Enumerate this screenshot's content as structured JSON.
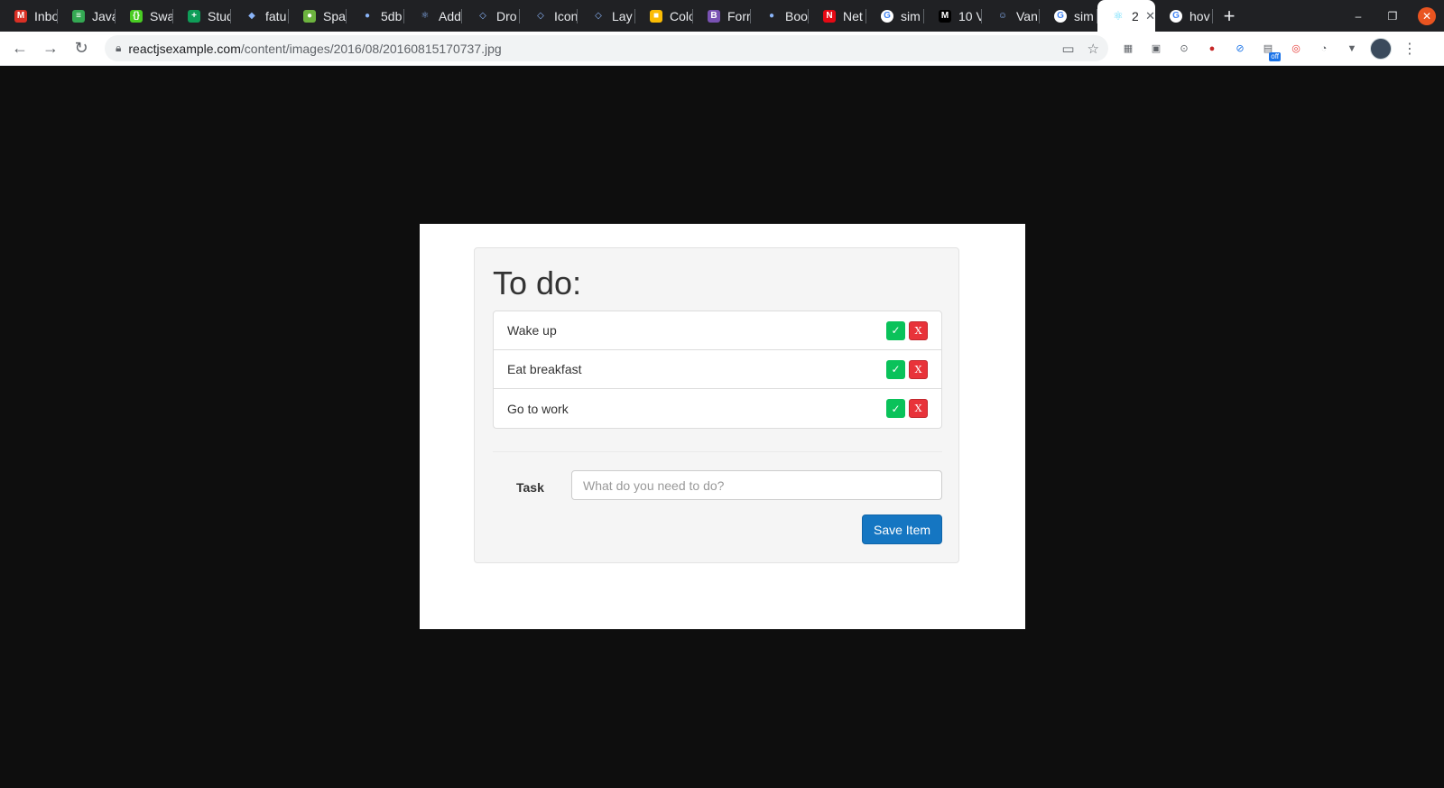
{
  "browser": {
    "tabs": [
      {
        "label": "Inbo",
        "icon": "gmail-icon",
        "color": "#d93025",
        "glyph": "M"
      },
      {
        "label": "Java",
        "icon": "code-icon",
        "color": "#34a853",
        "glyph": "≡"
      },
      {
        "label": "Swa",
        "icon": "swagger-icon",
        "color": "#49cc23",
        "glyph": "{}"
      },
      {
        "label": "Stud",
        "icon": "sheets-icon",
        "color": "#0f9d58",
        "glyph": "+"
      },
      {
        "label": "fatu",
        "icon": "shield-icon",
        "color": "#3c4043",
        "glyph": "◆"
      },
      {
        "label": "Spa",
        "icon": "spring-icon",
        "color": "#6db33f",
        "glyph": "●"
      },
      {
        "label": "5db",
        "icon": "globe-icon",
        "color": "#3c4043",
        "glyph": "●"
      },
      {
        "label": "Add",
        "icon": "react-icon",
        "color": "#202124",
        "glyph": "⚛"
      },
      {
        "label": "Dro",
        "icon": "diamond-icon",
        "color": "#202124",
        "glyph": "◇"
      },
      {
        "label": "Icon",
        "icon": "diamond-icon",
        "color": "#202124",
        "glyph": "◇"
      },
      {
        "label": "Lay",
        "icon": "diamond-icon",
        "color": "#202124",
        "glyph": "◇"
      },
      {
        "label": "Colo",
        "icon": "palette-icon",
        "color": "#fbbc04",
        "glyph": "■"
      },
      {
        "label": "Forr",
        "icon": "bootstrap-icon",
        "color": "#7952b3",
        "glyph": "B"
      },
      {
        "label": "Boo",
        "icon": "globe-icon",
        "color": "#3c4043",
        "glyph": "●"
      },
      {
        "label": "Net",
        "icon": "netflix-icon",
        "color": "#e50914",
        "glyph": "N"
      },
      {
        "label": "sim",
        "icon": "google-icon",
        "color": "#ffffff",
        "glyph": "G"
      },
      {
        "label": "10 V",
        "icon": "medium-icon",
        "color": "#000000",
        "glyph": "M"
      },
      {
        "label": "Van",
        "icon": "person-icon",
        "color": "#202124",
        "glyph": "☺"
      },
      {
        "label": "sim",
        "icon": "google-icon",
        "color": "#ffffff",
        "glyph": "G"
      }
    ],
    "active_tab": {
      "label": "2",
      "icon": "react-icon"
    },
    "last_tab": {
      "label": "hov",
      "icon": "google-icon"
    },
    "url_host": "reactjsexample.com",
    "url_path": "/content/images/2016/08/20160815170737.jpg"
  },
  "app": {
    "title": "To do:",
    "items": [
      {
        "text": "Wake up"
      },
      {
        "text": "Eat breakfast"
      },
      {
        "text": "Go to work"
      }
    ],
    "done_glyph": "✓",
    "delete_glyph": "X",
    "task_label": "Task",
    "task_placeholder": "What do you need to do?",
    "save_label": "Save Item"
  }
}
